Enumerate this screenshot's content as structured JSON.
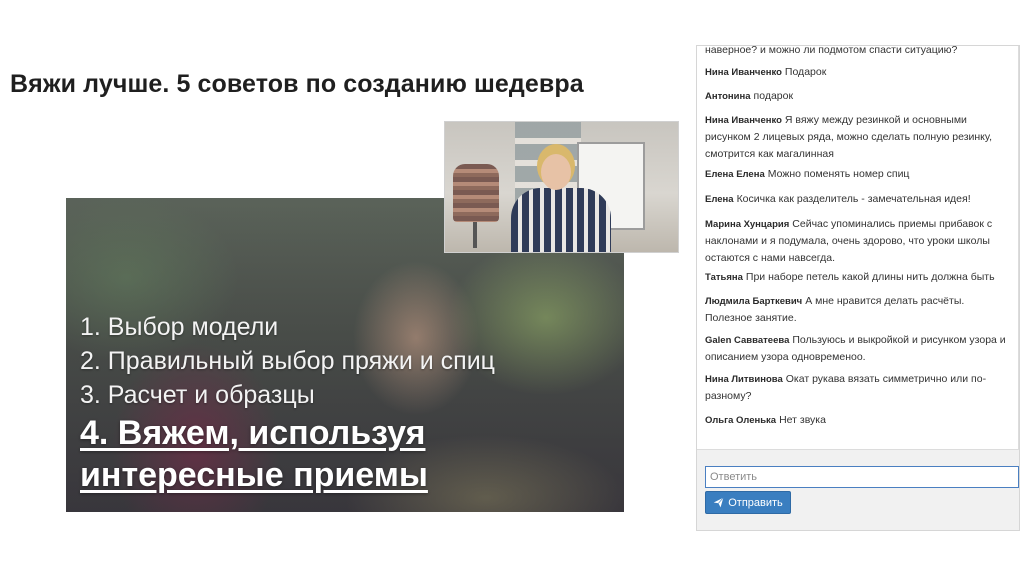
{
  "page": {
    "title": "Вяжи лучше. 5 советов по созданию шедевра"
  },
  "slide": {
    "items": [
      "1. Выбор модели",
      "2. Правильный выбор пряжи и спиц",
      "3. Расчет и образцы"
    ],
    "active_item": "4. Вяжем, используя интересные приемы"
  },
  "chat": {
    "top_text": "наверное? и можно ли подмотом спасти ситуацию?",
    "messages": [
      {
        "author": "Нина Иванченко",
        "text": "Подарок"
      },
      {
        "author": "Антонина",
        "text": "подарок"
      },
      {
        "author": "Нина Иванченко",
        "text": "Я вяжу между резинкой и основными рисунком 2 лицевых ряда, можно сделать полную резинку, смотрится как магалинная"
      },
      {
        "author": "Елена Елена",
        "text": "Можно поменять номер спиц"
      },
      {
        "author": "Елена",
        "text": "Косичка как разделитель - замечательная идея!"
      },
      {
        "author": "Марина Хунцария",
        "text": "Сейчас упоминались приемы прибавок с наклонами и я подумала, очень здорово, что уроки школы остаются с нами навсегда."
      },
      {
        "author": "Татьяна",
        "text": "При наборе петель какой длины нить должна быть"
      },
      {
        "author": "Людмила Барткевич",
        "text": "А мне нравится делать расчёты. Полезное занятие."
      },
      {
        "author": "Galen Савватеева",
        "text": "Пользуюсь и выкройкой и рисунком узора и описанием узора одновременоо."
      },
      {
        "author": "Нина Литвинова",
        "text": "Окат рукава вязать симметрично или по-разному?"
      },
      {
        "author": "Ольга Оленька",
        "text": "Нет звука"
      }
    ],
    "reply_placeholder": "Ответить",
    "send_label": "Отправить",
    "send_icon": "paper-plane-icon",
    "accent_color": "#3a7ec0"
  }
}
